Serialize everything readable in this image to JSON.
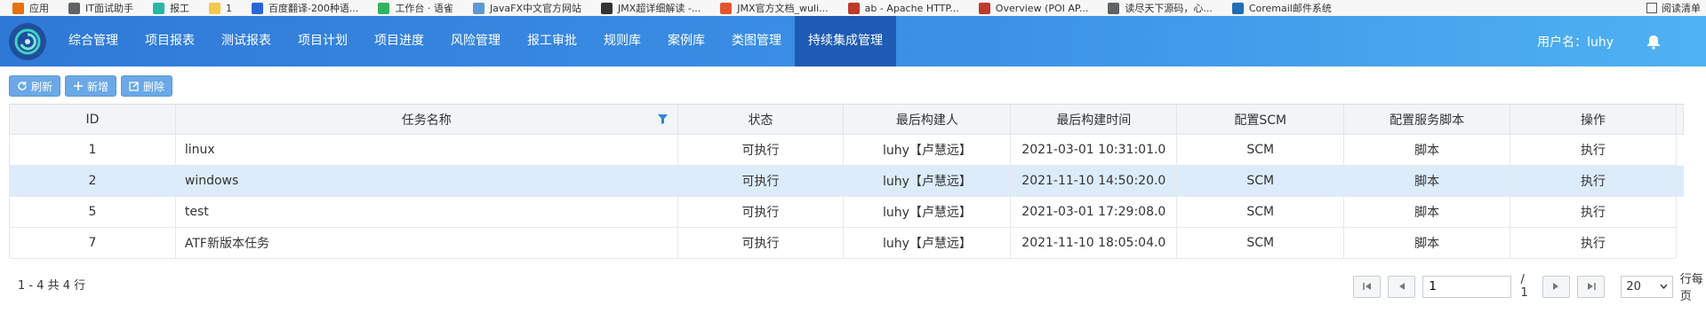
{
  "bookmarks": [
    {
      "label": "应用",
      "icon": "apps-grid-icon",
      "color": "#e8710a"
    },
    {
      "label": "IT面试助手",
      "icon": "globe-icon",
      "color": "#5f6368"
    },
    {
      "label": "报工",
      "icon": "swirl-icon",
      "color": "#2ab7a9"
    },
    {
      "label": "1",
      "icon": "folder-icon",
      "color": "#f2c94c"
    },
    {
      "label": "百度翻译-200种语...",
      "icon": "translate-icon",
      "color": "#2b66d9"
    },
    {
      "label": "工作台 · 语雀",
      "icon": "yuque-icon",
      "color": "#2fb55d"
    },
    {
      "label": "JavaFX中文官方网站",
      "icon": "javafx-icon",
      "color": "#5b9bd5"
    },
    {
      "label": "JMX超详细解读 -...",
      "icon": "jmx-icon",
      "color": "#333333"
    },
    {
      "label": "JMX官方文档_wuli...",
      "icon": "csdn-icon",
      "color": "#e4572e"
    },
    {
      "label": "ab - Apache HTTP...",
      "icon": "apache-feather-icon",
      "color": "#c0392b"
    },
    {
      "label": "Overview (POI AP...",
      "icon": "apache-feather-icon",
      "color": "#c0392b"
    },
    {
      "label": "读尽天下源码，心...",
      "icon": "globe-icon",
      "color": "#5f6368"
    },
    {
      "label": "Coremail邮件系统",
      "icon": "coremail-icon",
      "color": "#1e6fb8"
    }
  ],
  "reading_list": "阅读清单",
  "nav": {
    "items": [
      "综合管理",
      "项目报表",
      "测试报表",
      "项目计划",
      "项目进度",
      "风险管理",
      "报工审批",
      "规则库",
      "案例库",
      "类图管理",
      "持续集成管理"
    ],
    "active_index": 10,
    "user_label": "用户名：luhy"
  },
  "toolbar": {
    "refresh": "刷新",
    "add": "新增",
    "delete": "删除"
  },
  "table": {
    "headers": {
      "id": "ID",
      "name": "任务名称",
      "status": "状态",
      "builder": "最后构建人",
      "time": "最后构建时间",
      "scm": "配置SCM",
      "script": "配置服务脚本",
      "op": "操作"
    },
    "rows": [
      {
        "id": "1",
        "name": "linux",
        "status": "可执行",
        "builder": "luhy【卢慧远】",
        "time": "2021-03-01 10:31:01.0",
        "scm": "SCM",
        "script": "脚本",
        "op": "执行"
      },
      {
        "id": "2",
        "name": "windows",
        "status": "可执行",
        "builder": "luhy【卢慧远】",
        "time": "2021-11-10 14:50:20.0",
        "scm": "SCM",
        "script": "脚本",
        "op": "执行"
      },
      {
        "id": "5",
        "name": "test",
        "status": "可执行",
        "builder": "luhy【卢慧远】",
        "time": "2021-03-01 17:29:08.0",
        "scm": "SCM",
        "script": "脚本",
        "op": "执行"
      },
      {
        "id": "7",
        "name": "ATF新版本任务",
        "status": "可执行",
        "builder": "luhy【卢慧远】",
        "time": "2021-11-10 18:05:04.0",
        "scm": "SCM",
        "script": "脚本",
        "op": "执行"
      }
    ],
    "selected_index": 1
  },
  "footer": {
    "range_text": "1 - 4 共 4 行"
  },
  "pager": {
    "page": "1",
    "total": "/ 1",
    "page_size": "20",
    "per_page_label": "行每页"
  }
}
